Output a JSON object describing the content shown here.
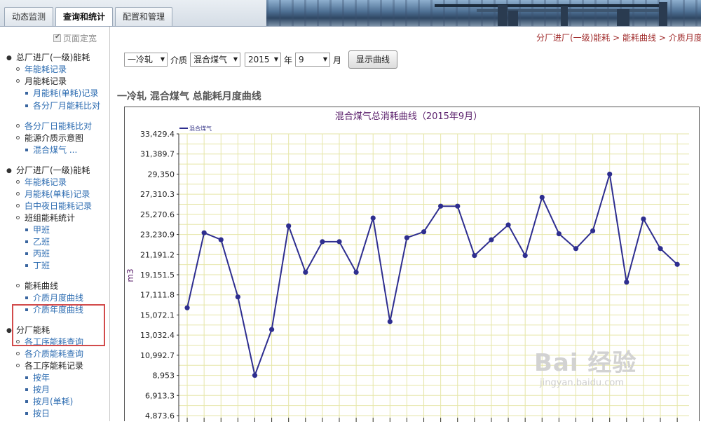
{
  "tabs": [
    {
      "label": "动态监测",
      "active": false
    },
    {
      "label": "查询和统计",
      "active": true
    },
    {
      "label": "配置和管理",
      "active": false
    }
  ],
  "sidebar": {
    "fix_width_label": "页面定宽",
    "groups": [
      {
        "title": "总厂进厂(一级)能耗"
      },
      {
        "title": "分厂进厂(一级)能耗"
      },
      {
        "title": "分厂能耗"
      }
    ],
    "items": {
      "g1_year": "年能耗记录",
      "g1_month": "月能耗记录",
      "g1_month_single": "月能耗(单耗)记录",
      "g1_month_compare": "各分厂月能耗比对",
      "g1_day_compare": "各分厂日能耗比对",
      "g1_media_diagram": "能源介质示意图",
      "g1_mixed_gas": "混合煤气 ...",
      "g2_year": "年能耗记录",
      "g2_month_single": "月能耗(单耗)记录",
      "g2_daynight": "白中夜日能耗记录",
      "g2_team_stats": "班组能耗统计",
      "g2_team_a": "甲班",
      "g2_team_b": "乙班",
      "g2_team_c": "丙班",
      "g2_team_d": "丁班",
      "g2_curves": "能耗曲线",
      "g2_media_month_curve": "介质月度曲线",
      "g2_media_year_curve": "介质年度曲线",
      "g3_process_query": "各工序能耗查询",
      "g3_media_query": "各介质能耗查询",
      "g3_process_record": "各工序能耗记录",
      "g3_by_year": "按年",
      "g3_by_month": "按月",
      "g3_by_month_single": "按月(单耗)",
      "g3_by_day": "按日"
    }
  },
  "breadcrumb": "分厂进厂(一级)能耗 > 能耗曲线 > 介质月度曲线",
  "controls": {
    "plant": "一冷轧",
    "media_label": "介质",
    "media": "混合煤气",
    "year": "2015",
    "year_unit": "年",
    "month": "9",
    "month_unit": "月",
    "show_button": "显示曲线"
  },
  "section_title": "一冷轧 混合煤气 总能耗月度曲线",
  "watermark": {
    "brand": "Bai 经验",
    "url": "jingyan.baidu.com"
  },
  "colors": {
    "line": "#2e2e8f",
    "grid": "#e6e6a8",
    "title": "#5a1f6b",
    "breadcrumb": "#a02b2b",
    "highlight": "#d24b4b"
  },
  "chart_data": {
    "type": "line",
    "title": "混合煤气总消耗曲线（2015年9月）",
    "ylabel": "m3",
    "xlabel": "",
    "legend": "混合煤气",
    "legend_position": "top-left",
    "ylim": [
      4873.6,
      33429.4
    ],
    "yticks": [
      "33,429.4",
      "31,389.7",
      "29,350",
      "27,310.3",
      "25,270.6",
      "23,230.9",
      "21,191.2",
      "19,151.5",
      "17,111.8",
      "15,072.1",
      "13,032.4",
      "10,992.7",
      "8,953",
      "6,913.3",
      "4,873.6"
    ],
    "grid": true,
    "series": [
      {
        "name": "混合煤气",
        "values": [
          15800,
          23400,
          22700,
          16900,
          8950,
          13600,
          24100,
          19400,
          22500,
          22500,
          19400,
          24900,
          14400,
          22900,
          23500,
          26100,
          26100,
          21100,
          22700,
          24200,
          21100,
          27000,
          23300,
          21800,
          23600,
          29350,
          18400,
          24800,
          21800,
          20200
        ]
      }
    ]
  }
}
